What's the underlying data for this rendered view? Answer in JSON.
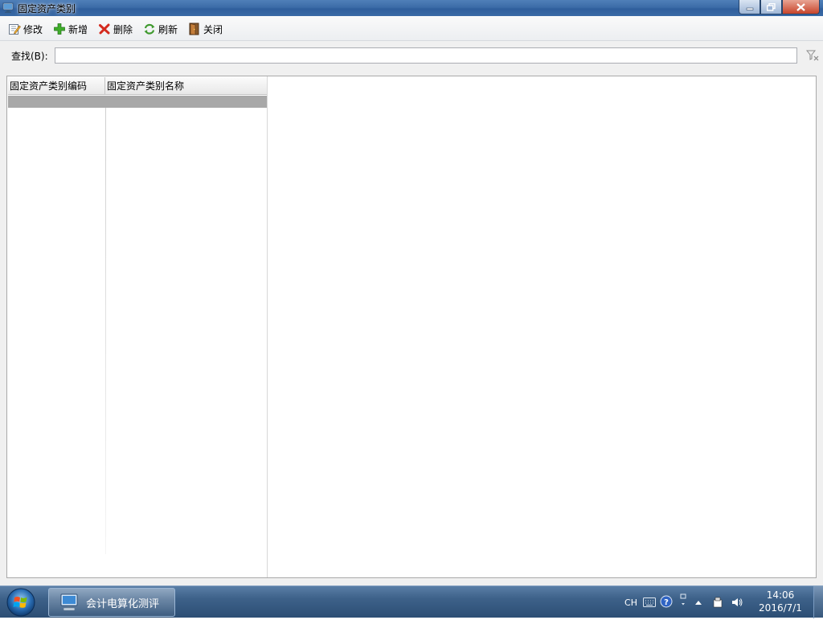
{
  "window": {
    "title": "固定资产类别"
  },
  "toolbar": {
    "edit_label": "修改",
    "add_label": "新增",
    "delete_label": "删除",
    "refresh_label": "刷新",
    "close_label": "关闭"
  },
  "search": {
    "label": "查找(B):",
    "value": "",
    "placeholder": ""
  },
  "grid": {
    "columns": [
      "固定资产类别编码",
      "固定资产类别名称"
    ],
    "rows": [
      [
        "",
        ""
      ]
    ]
  },
  "taskbar": {
    "task_label": "会计电算化测评",
    "ime_label": "CH",
    "time": "14:06",
    "date": "2016/7/1"
  },
  "colors": {
    "title_bar": "#3c6ca8",
    "selected_row": "#a8a8a8",
    "taskbar": "#3d6189"
  }
}
